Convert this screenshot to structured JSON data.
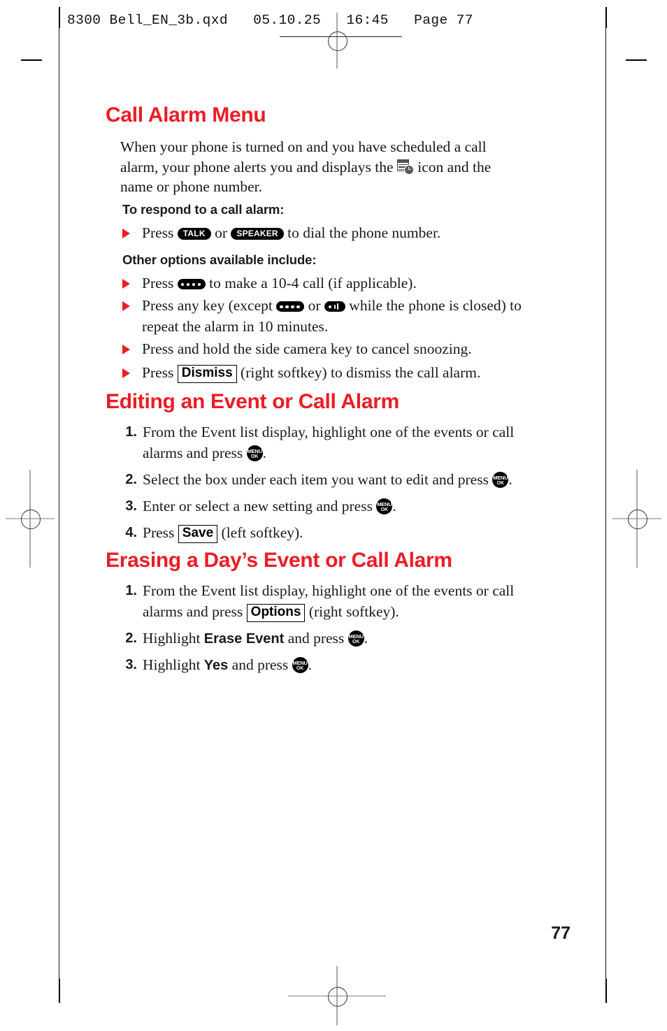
{
  "print_marks": {
    "file_header": "8300 Bell_EN_3b.qxd   05.10.25   16:45   Page 77"
  },
  "page": {
    "number": "77"
  },
  "sections": [
    {
      "id": "call-alarm-menu",
      "title": "Call Alarm Menu",
      "intro_part1": "When your phone is turned on and you have scheduled a call alarm, your phone alerts you and displays the ",
      "intro_icon": "call-alarm-icon",
      "intro_part2": " icon and the name or phone number.",
      "label_respond": "To respond to a call alarm:",
      "bullet_press": "Press ",
      "key_talk": "TALK",
      "or_word": " or ",
      "key_speaker": "SPEAKER",
      "bullet_press_tail": " to dial the phone number.",
      "label_other": "Other options available include:",
      "bullet2_head": "Press ",
      "bullet2_tail": " to make a 10-4 call (if applicable).",
      "bullet3_head": "Press any key (except ",
      "bullet3_mid": " or ",
      "bullet3_tail": " while the phone is closed) to repeat the alarm in 10 minutes.",
      "bullet4": "Press and hold the side camera key to cancel snoozing.",
      "bullet5_head": "Press ",
      "bullet5_softkey": "Dismiss",
      "bullet5_tail": " (right softkey) to dismiss the call alarm."
    },
    {
      "id": "editing-event",
      "title": "Editing an Event or Call Alarm",
      "steps": [
        {
          "num": "1.",
          "head": "From the Event list display, highlight one of the events or call alarms and press ",
          "tail": "."
        },
        {
          "num": "2.",
          "head": "Select the box under each item you want to edit and press ",
          "tail": "."
        },
        {
          "num": "3.",
          "head": "Enter or select a new setting and press ",
          "tail": "."
        },
        {
          "num": "4.",
          "head": "Press ",
          "softkey": "Save",
          "tail": " (left softkey)."
        }
      ]
    },
    {
      "id": "erasing-day",
      "title": "Erasing a Day’s Event or Call Alarm",
      "steps": [
        {
          "num": "1.",
          "head": "From the Event list display, highlight one of the events or call alarms and press ",
          "softkey": "Options",
          "tail": " (right softkey)."
        },
        {
          "num": "2.",
          "head": "Highlight ",
          "bold": "Erase Event",
          "mid": " and press ",
          "tail": "."
        },
        {
          "num": "3.",
          "head": "Highlight ",
          "bold": "Yes",
          "mid": " and press ",
          "tail": "."
        }
      ]
    }
  ],
  "keys": {
    "menu_top": "MENU",
    "menu_bottom": "OK",
    "talk": "TALK",
    "speaker": "SPEAKER"
  },
  "colors": {
    "heading_red": "#ed1c24",
    "bullet_red": "#ed1c24",
    "text": "#161616"
  }
}
